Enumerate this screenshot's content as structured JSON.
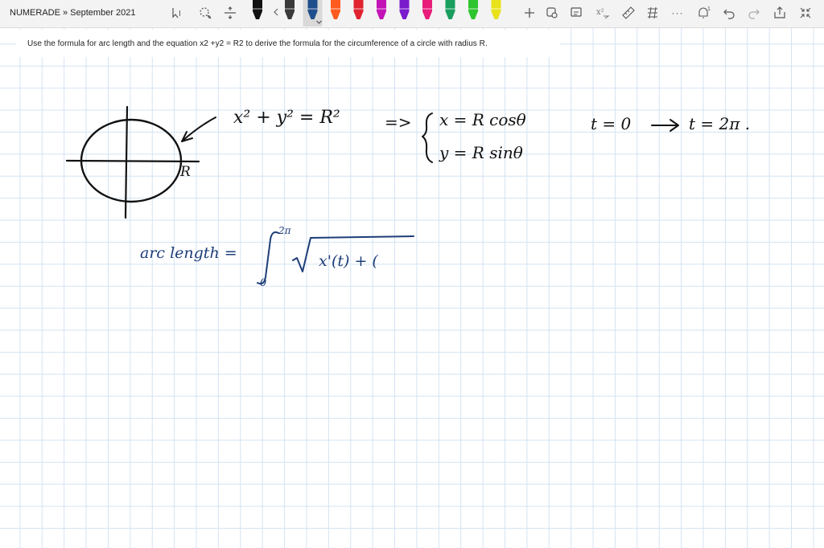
{
  "app": {
    "title": "NUMERADE » September 2021"
  },
  "toolbar": {
    "icons": [
      "select-text-icon",
      "lasso-select-icon",
      "insert-space-icon",
      "undo-icon",
      "redo-icon",
      "share-icon",
      "fullscreen-icon"
    ],
    "pens": [
      {
        "color": "#111111"
      },
      {
        "color": "#3a3a3a"
      },
      {
        "color": "#1f4e8c",
        "selected": true
      },
      {
        "color": "#ff5a1f"
      },
      {
        "color": "#e0232f"
      },
      {
        "color": "#c214b6"
      },
      {
        "color": "#7a1bcc"
      },
      {
        "color": "#e81d7a"
      },
      {
        "color": "#1a9e5e"
      },
      {
        "color": "#2ec52e"
      },
      {
        "color": "#e8e21a"
      }
    ],
    "more_label": "···"
  },
  "question": {
    "text": "Use the formula for arc length and the equation x2 +y2 = R2 to derive the formula for the circumference of a circle with radius R."
  },
  "handwriting": {
    "circle_label": "R",
    "equation": "x² + y² = R²",
    "implies": "=>",
    "param_x": "x = R cosθ",
    "param_y": "y = R sinθ",
    "t_start": "t = 0",
    "t_end": "t = 2π .",
    "arc_label": "arc length  =",
    "upper_limit": "2π",
    "lower_limit": "0",
    "integrand": "x'(t) + ("
  }
}
